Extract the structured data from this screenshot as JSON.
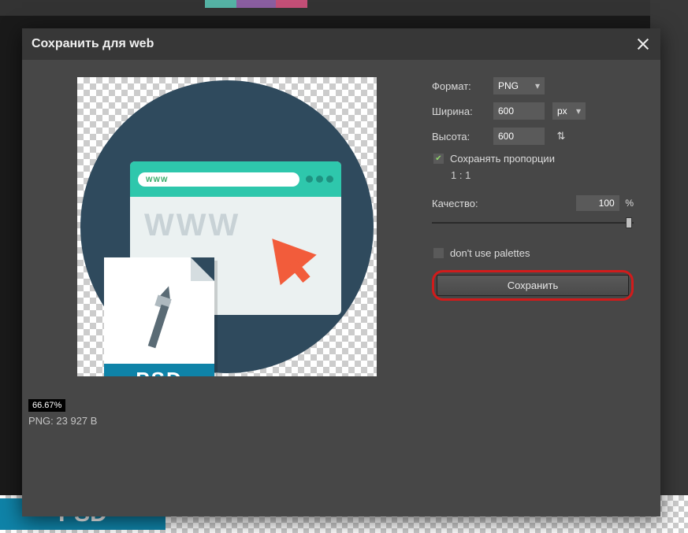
{
  "dialog": {
    "title": "Сохранить для web"
  },
  "format": {
    "label": "Формат:",
    "value": "PNG"
  },
  "width": {
    "label": "Ширина:",
    "value": "600",
    "unit": "px"
  },
  "height": {
    "label": "Высота:",
    "value": "600"
  },
  "constrain": {
    "label": "Сохранять пропорции",
    "checked": true
  },
  "ratio": "1 : 1",
  "quality": {
    "label": "Качество:",
    "value": "100",
    "suffix": "%"
  },
  "palettes": {
    "label": "don't use palettes",
    "checked": false
  },
  "save_button": "Сохранить",
  "zoom": "66.67%",
  "filesize": "PNG: 23 927 B",
  "preview": {
    "www_abbr": "WWW",
    "www_big": "WWW",
    "psd": "PSD",
    "psd_bg": "PSD"
  }
}
